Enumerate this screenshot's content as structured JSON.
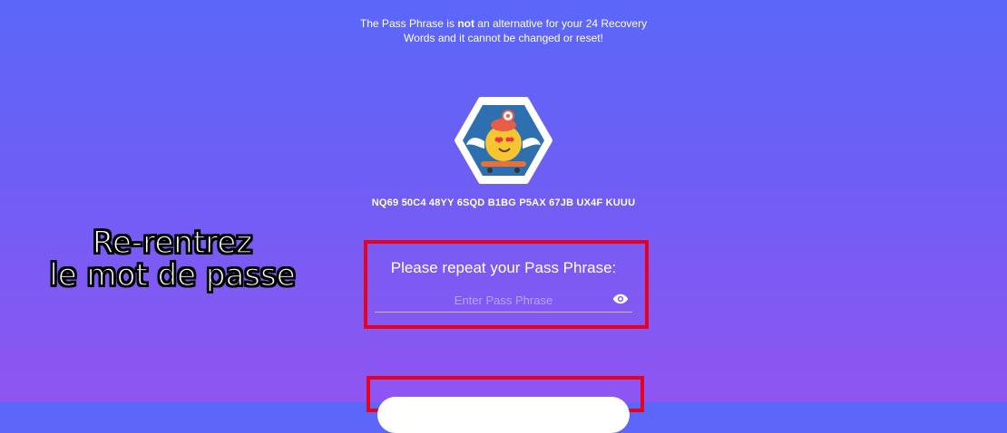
{
  "notice": {
    "part1": "The Pass Phrase is ",
    "emphasis": "not",
    "part2": " an alternative for your 24 Recovery",
    "line2": "Words and it cannot be changed or reset!"
  },
  "account": {
    "id": "NQ69 50C4 48YY 6SQD B1BG P5AX 67JB UX4F KUUU",
    "avatar_icon": "robot-avatar-icon"
  },
  "annotation": {
    "line1": "Re-rentrez",
    "line2": "le mot de passe"
  },
  "passphrase": {
    "label": "Please repeat your Pass Phrase:",
    "placeholder": "Enter Pass Phrase",
    "value": "",
    "toggle_icon": "eye-icon"
  },
  "colors": {
    "background_top": "#5a67f8",
    "background_bottom": "#8f55f2",
    "highlight": "#e8001c"
  }
}
